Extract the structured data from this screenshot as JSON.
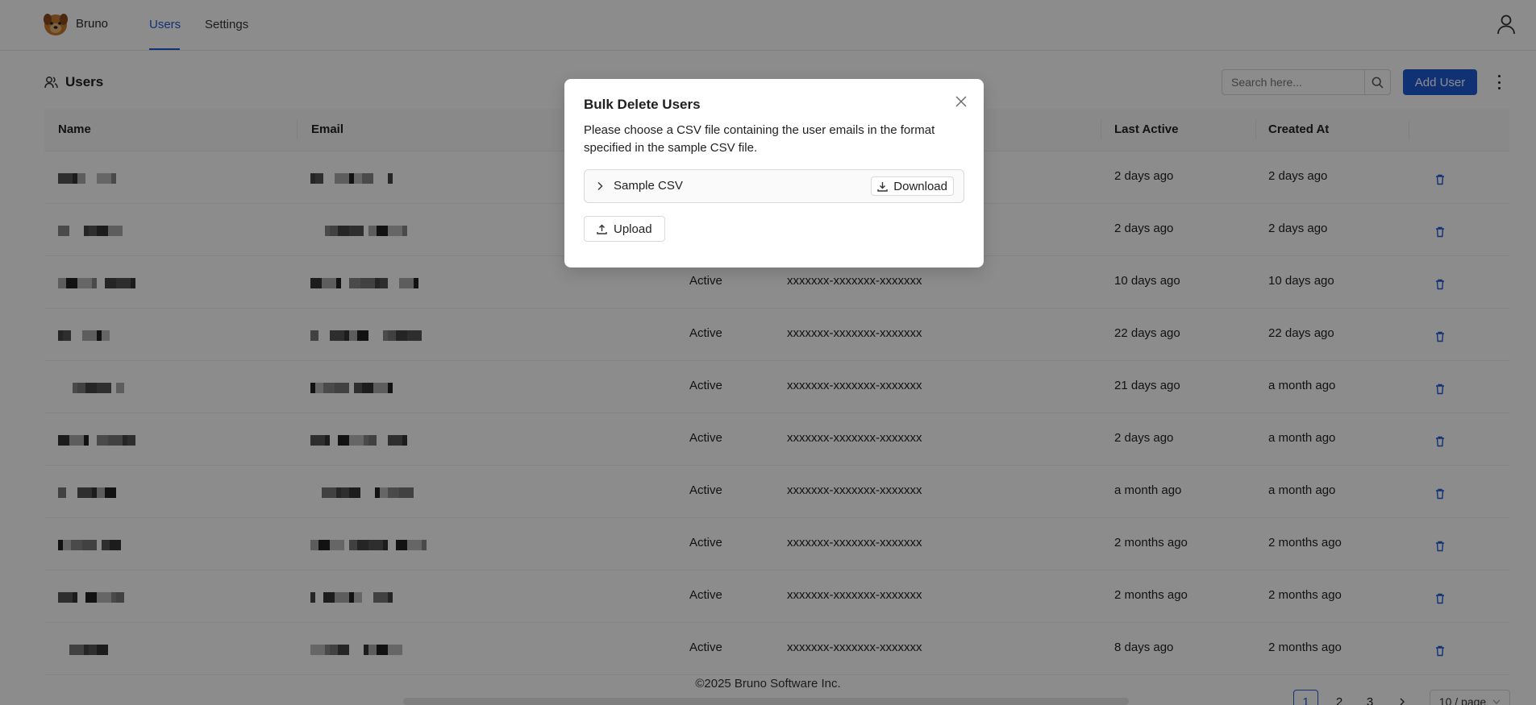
{
  "app": {
    "brand": "Bruno"
  },
  "nav": {
    "tabs": [
      {
        "label": "Users",
        "active": true
      },
      {
        "label": "Settings",
        "active": false
      }
    ]
  },
  "page": {
    "title": "Users"
  },
  "search": {
    "placeholder": "Search here..."
  },
  "actions": {
    "add_user": "Add User"
  },
  "table": {
    "headers": {
      "name": "Name",
      "email": "Email",
      "last_active": "Last Active",
      "created_at": "Created At"
    },
    "rows": [
      {
        "status": "",
        "id": "",
        "last_active": "2 days ago",
        "created_at": "2 days ago"
      },
      {
        "status": "",
        "id": "",
        "last_active": "2 days ago",
        "created_at": "2 days ago"
      },
      {
        "status": "Active",
        "id": "xxxxxxx-xxxxxxx-xxxxxxx",
        "last_active": "10 days ago",
        "created_at": "10 days ago"
      },
      {
        "status": "Active",
        "id": "xxxxxxx-xxxxxxx-xxxxxxx",
        "last_active": "22 days ago",
        "created_at": "22 days ago"
      },
      {
        "status": "Active",
        "id": "xxxxxxx-xxxxxxx-xxxxxxx",
        "last_active": "21 days ago",
        "created_at": "a month ago"
      },
      {
        "status": "Active",
        "id": "xxxxxxx-xxxxxxx-xxxxxxx",
        "last_active": "2 days ago",
        "created_at": "a month ago"
      },
      {
        "status": "Active",
        "id": "xxxxxxx-xxxxxxx-xxxxxxx",
        "last_active": "a month ago",
        "created_at": "a month ago"
      },
      {
        "status": "Active",
        "id": "xxxxxxx-xxxxxxx-xxxxxxx",
        "last_active": "2 months ago",
        "created_at": "2 months ago"
      },
      {
        "status": "Active",
        "id": "xxxxxxx-xxxxxxx-xxxxxxx",
        "last_active": "2 months ago",
        "created_at": "2 months ago"
      },
      {
        "status": "Active",
        "id": "xxxxxxx-xxxxxxx-xxxxxxx",
        "last_active": "8 days ago",
        "created_at": "2 months ago"
      }
    ]
  },
  "footer": {
    "copyright": "©2025 Bruno Software Inc."
  },
  "pagination": {
    "pages": [
      "1",
      "2",
      "3"
    ],
    "current": "1",
    "page_size": "10 / page"
  },
  "modal": {
    "title": "Bulk Delete Users",
    "description": "Please choose a CSV file containing the user emails in the format specified in the sample CSV file.",
    "sample_label": "Sample CSV",
    "download_label": "Download",
    "upload_label": "Upload"
  },
  "colors": {
    "primary": "#1e5bd6",
    "overlay": "rgba(0,0,0,0.45)"
  }
}
